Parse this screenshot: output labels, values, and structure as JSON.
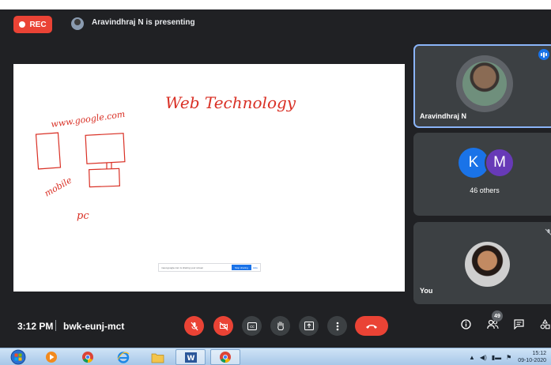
{
  "recording": {
    "label": "REC"
  },
  "presenter": {
    "text": "Aravindhraj N is presenting"
  },
  "whiteboard": {
    "title": "Web Technology",
    "url": "www.google.com",
    "mobile_label": "mobile",
    "pc_label": "pc",
    "share_bar": {
      "text": "meet.google.com is sharing your screen",
      "stop_label": "Stop sharing",
      "hide_label": "Hide"
    }
  },
  "participants": {
    "speaker_name": "Aravindhraj N",
    "others_initials": [
      "K",
      "M"
    ],
    "others_label": "46 others",
    "self_name": "You"
  },
  "meeting": {
    "time": "3:12 PM",
    "code": "bwk-eunj-mct"
  },
  "controls": {
    "participants_count": "49"
  },
  "taskbar": {
    "clock_time": "15:12",
    "clock_date": "09-10-2020"
  }
}
